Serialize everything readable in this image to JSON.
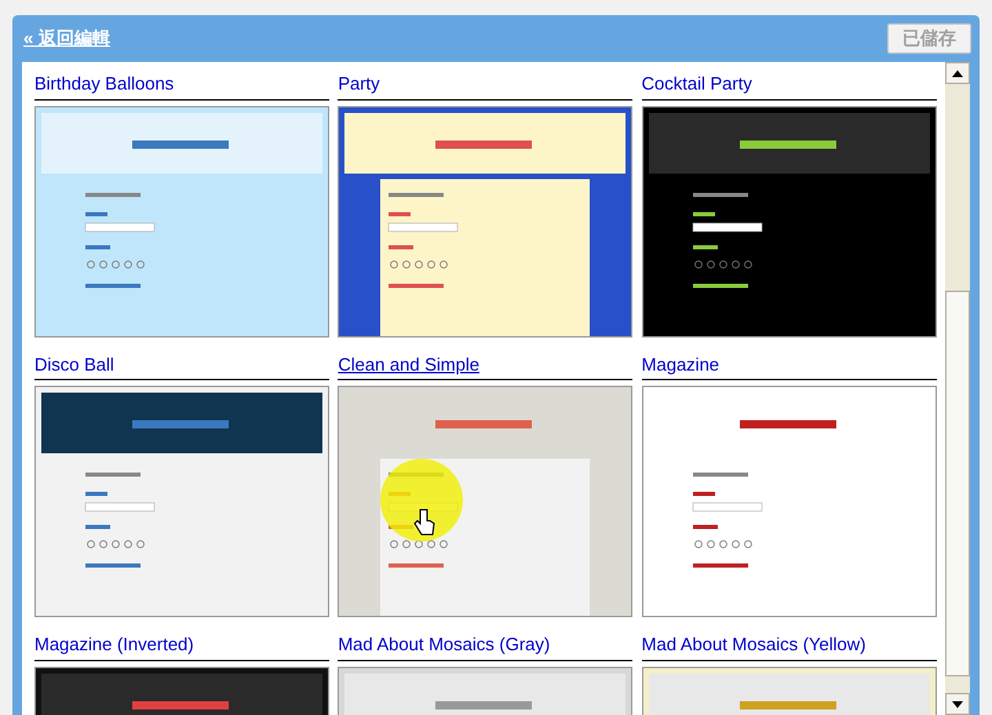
{
  "header": {
    "back_link": "« 返回編輯",
    "save_button": {
      "label": "已儲存",
      "disabled": true
    }
  },
  "themes": [
    {
      "name": "Birthday Balloons",
      "selected": false
    },
    {
      "name": "Party",
      "selected": false
    },
    {
      "name": "Cocktail Party",
      "selected": false
    },
    {
      "name": "Disco Ball",
      "selected": false
    },
    {
      "name": "Clean and Simple",
      "selected": true
    },
    {
      "name": "Magazine",
      "selected": false
    },
    {
      "name": "Magazine (Inverted)",
      "selected": false
    },
    {
      "name": "Mad About Mosaics (Gray)",
      "selected": false
    },
    {
      "name": "Mad About Mosaics (Yellow)",
      "selected": false
    }
  ]
}
